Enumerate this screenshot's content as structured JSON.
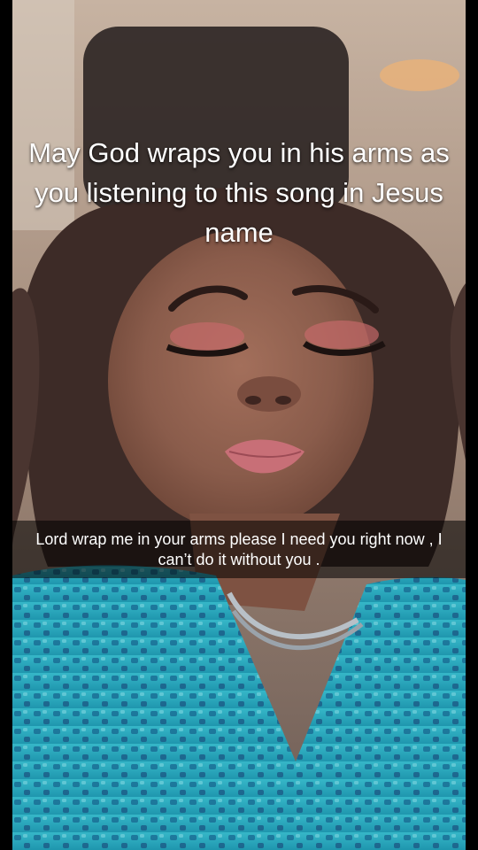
{
  "story": {
    "overlay_text": "May God wraps you in his arms as you listening to this song in Jesus name",
    "caption": "Lord wrap me in your arms please I need you right now , I can’t do it without you ."
  },
  "colors": {
    "caption_bar": "#000000",
    "text": "#ffffff",
    "top_background": "#b49a88",
    "hair": "#3b2a26",
    "skin": "#8a5d4c",
    "lips": "#c66b73",
    "shirt": "#2db1c4"
  }
}
